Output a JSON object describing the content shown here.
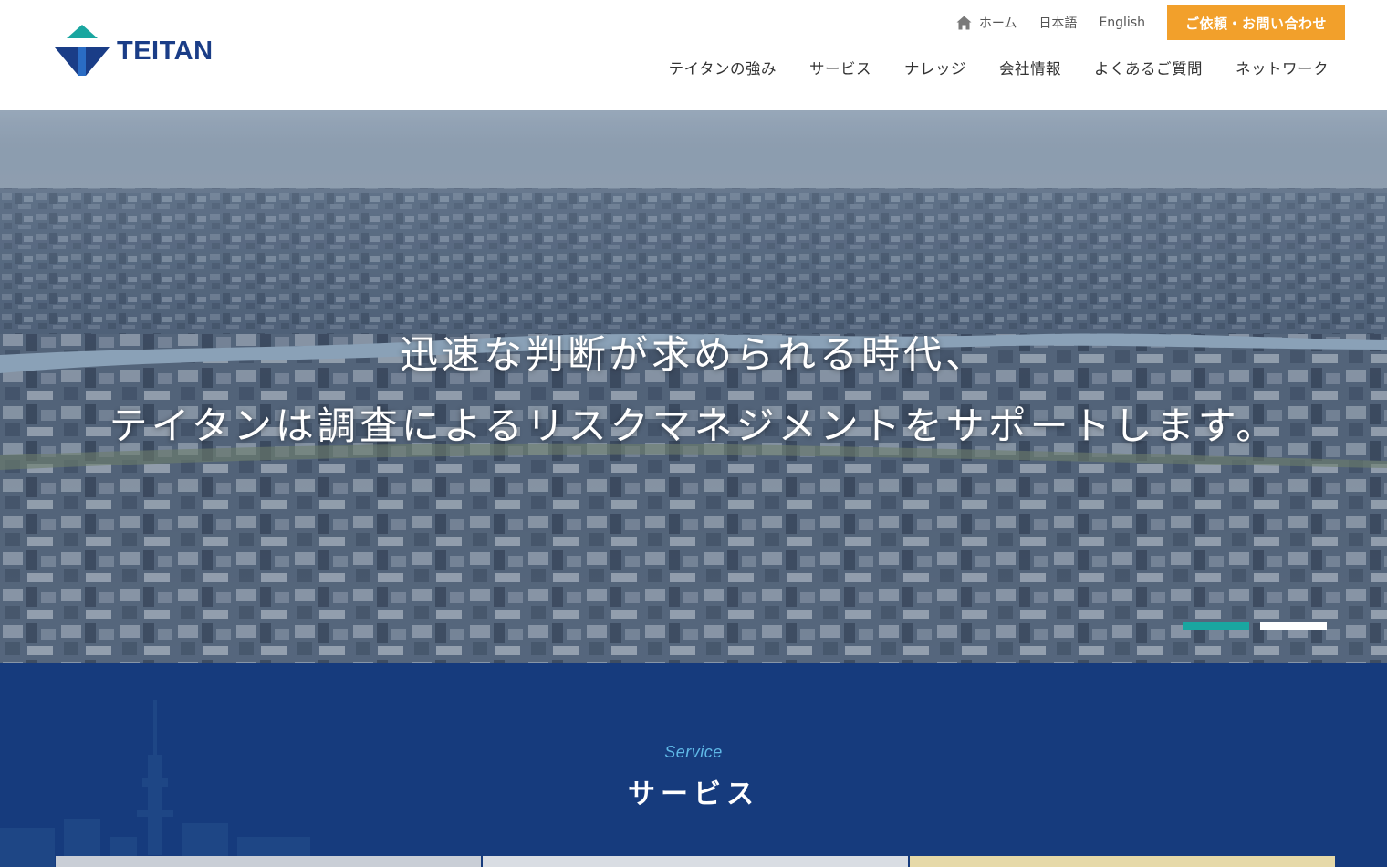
{
  "header": {
    "logo_text": "TEITAN",
    "utility": {
      "home": "ホーム",
      "japanese": "日本語",
      "english": "English",
      "contact": "ご依頼・お問い合わせ"
    },
    "nav": [
      {
        "label": "テイタンの強み"
      },
      {
        "label": "サービス"
      },
      {
        "label": "ナレッジ"
      },
      {
        "label": "会社情報"
      },
      {
        "label": "よくあるご質問"
      },
      {
        "label": "ネットワーク"
      }
    ]
  },
  "hero": {
    "line1": "迅速な判断が求められる時代、",
    "line2": "テイタンは調査によるリスクマネジメントをサポートします。",
    "slides": [
      {
        "active": true,
        "color": "#19a6a0"
      },
      {
        "active": false,
        "color": "#ffffff"
      }
    ]
  },
  "service": {
    "eyebrow": "Service",
    "title": "サービス"
  },
  "colors": {
    "brand_navy": "#1a3d87",
    "brand_teal": "#19a6a0",
    "cta_orange": "#f2a02b",
    "service_bg": "#163b7d"
  }
}
